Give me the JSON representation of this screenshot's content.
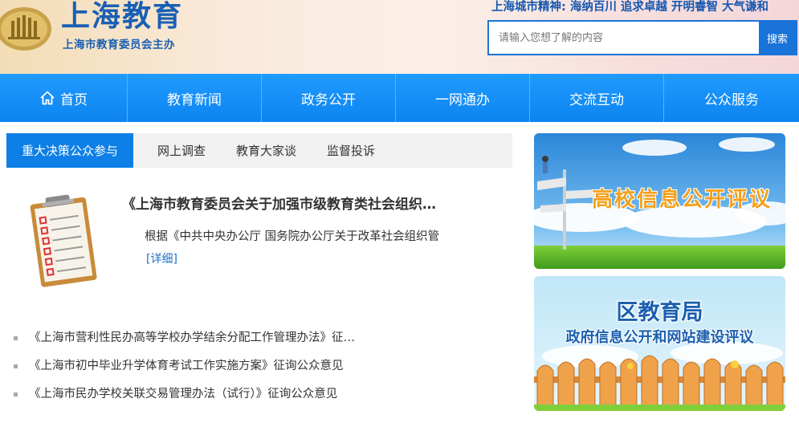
{
  "header": {
    "title": "上海教育",
    "subtitle": "上海市教育委员会主办",
    "spirit": "上海城市精神: 海纳百川 追求卓越 开明睿智 大气谦和",
    "search": {
      "placeholder": "请输入您想了解的内容",
      "button_label": "搜索"
    }
  },
  "nav": {
    "items": [
      {
        "label": "首页",
        "icon": "home-icon"
      },
      {
        "label": "教育新闻"
      },
      {
        "label": "政务公开"
      },
      {
        "label": "一网通办"
      },
      {
        "label": "交流互动"
      },
      {
        "label": "公众服务"
      }
    ]
  },
  "tabs": [
    {
      "label": "重大决策公众参与",
      "active": true
    },
    {
      "label": "网上调查"
    },
    {
      "label": "教育大家谈"
    },
    {
      "label": "监督投诉"
    }
  ],
  "featured": {
    "title": "《上海市教育委员会关于加强市级教育类社会组织…",
    "summary": "根据《中共中央办公厅 国务院办公厅关于改革社会组织管",
    "more_label": "[详细]",
    "image": "clipboard-checklist"
  },
  "list": [
    "《上海市营利性民办高等学校办学结余分配工作管理办法》征…",
    "《上海市初中毕业升学体育考试工作实施方案》征询公众意见",
    "《上海市民办学校关联交易管理办法（试行）》征询公众意见"
  ],
  "banners": {
    "first": {
      "title": "高校信息公开评议"
    },
    "second": {
      "title": "区教育局",
      "subtitle": "政府信息公开和网站建设评议"
    }
  },
  "colors": {
    "brand_blue": "#1a73d9",
    "nav_blue": "#0d84f0",
    "tab_active": "#0d7fe6",
    "title_blue": "#1a5fb4"
  }
}
